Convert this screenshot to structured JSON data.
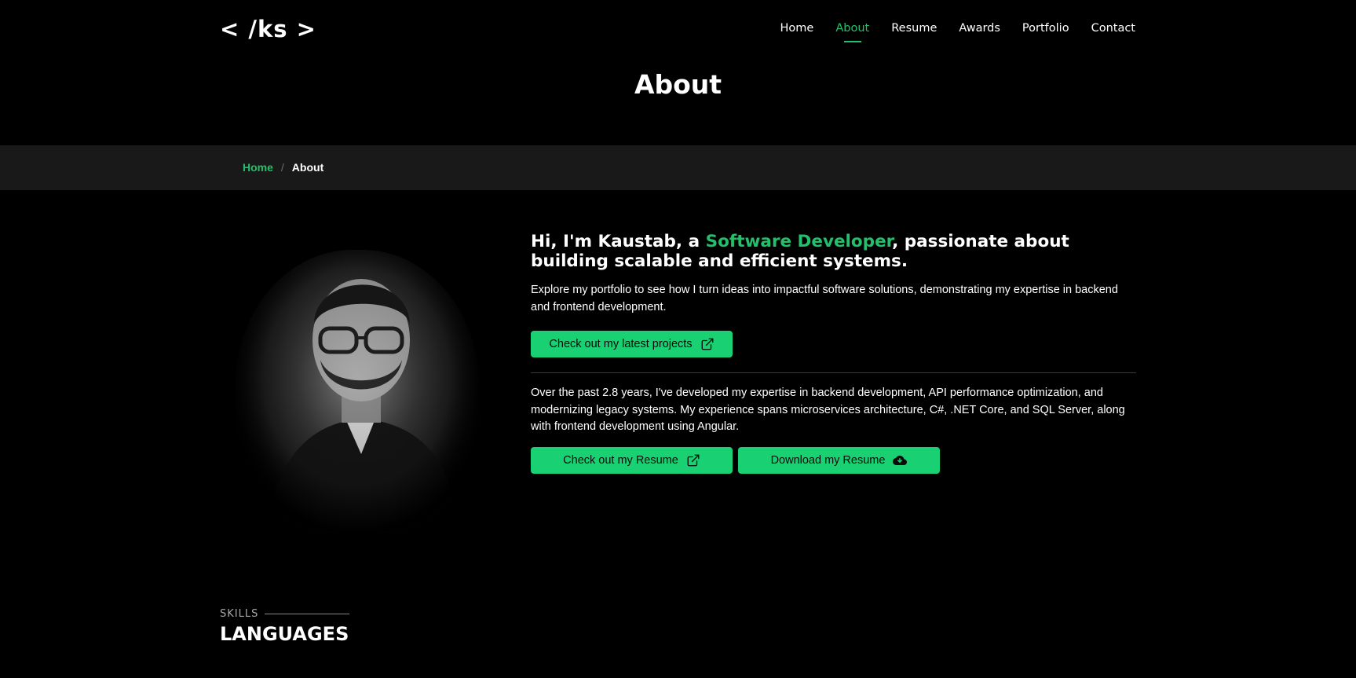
{
  "colors": {
    "accent": "#23c06b",
    "button_bg": "#19d173",
    "breadcrumb_bar": "#191919",
    "background": "#000000"
  },
  "header": {
    "logo_text": "< /ks >",
    "nav": [
      {
        "label": "Home",
        "active": false
      },
      {
        "label": "About",
        "active": true
      },
      {
        "label": "Resume",
        "active": false
      },
      {
        "label": "Awards",
        "active": false
      },
      {
        "label": "Portfolio",
        "active": false
      },
      {
        "label": "Contact",
        "active": false
      }
    ],
    "page_title": "About"
  },
  "breadcrumb": {
    "home": "Home",
    "separator": "/",
    "current": "About"
  },
  "about": {
    "headline_pre": "Hi, I'm Kaustab, a ",
    "headline_accent": "Software Developer",
    "headline_post": ", passionate about building scalable and efficient systems.",
    "intro": "Explore my portfolio to see how I turn ideas into impactful software solutions, demonstrating my expertise in backend and frontend development.",
    "projects_button": "Check out my latest projects",
    "projects_button_icon": "external-link-icon",
    "experience": "Over the past 2.8 years, I've developed my expertise in backend development, API performance optimization, and modernizing legacy systems. My experience spans microservices architecture, C#, .NET Core, and SQL Server, along with frontend development using Angular.",
    "resume_button": "Check out my Resume",
    "resume_button_icon": "external-link-icon",
    "download_button": "Download my Resume",
    "download_button_icon": "cloud-download-icon"
  },
  "skills": {
    "kicker": "SKILLS",
    "title": "LANGUAGES"
  }
}
